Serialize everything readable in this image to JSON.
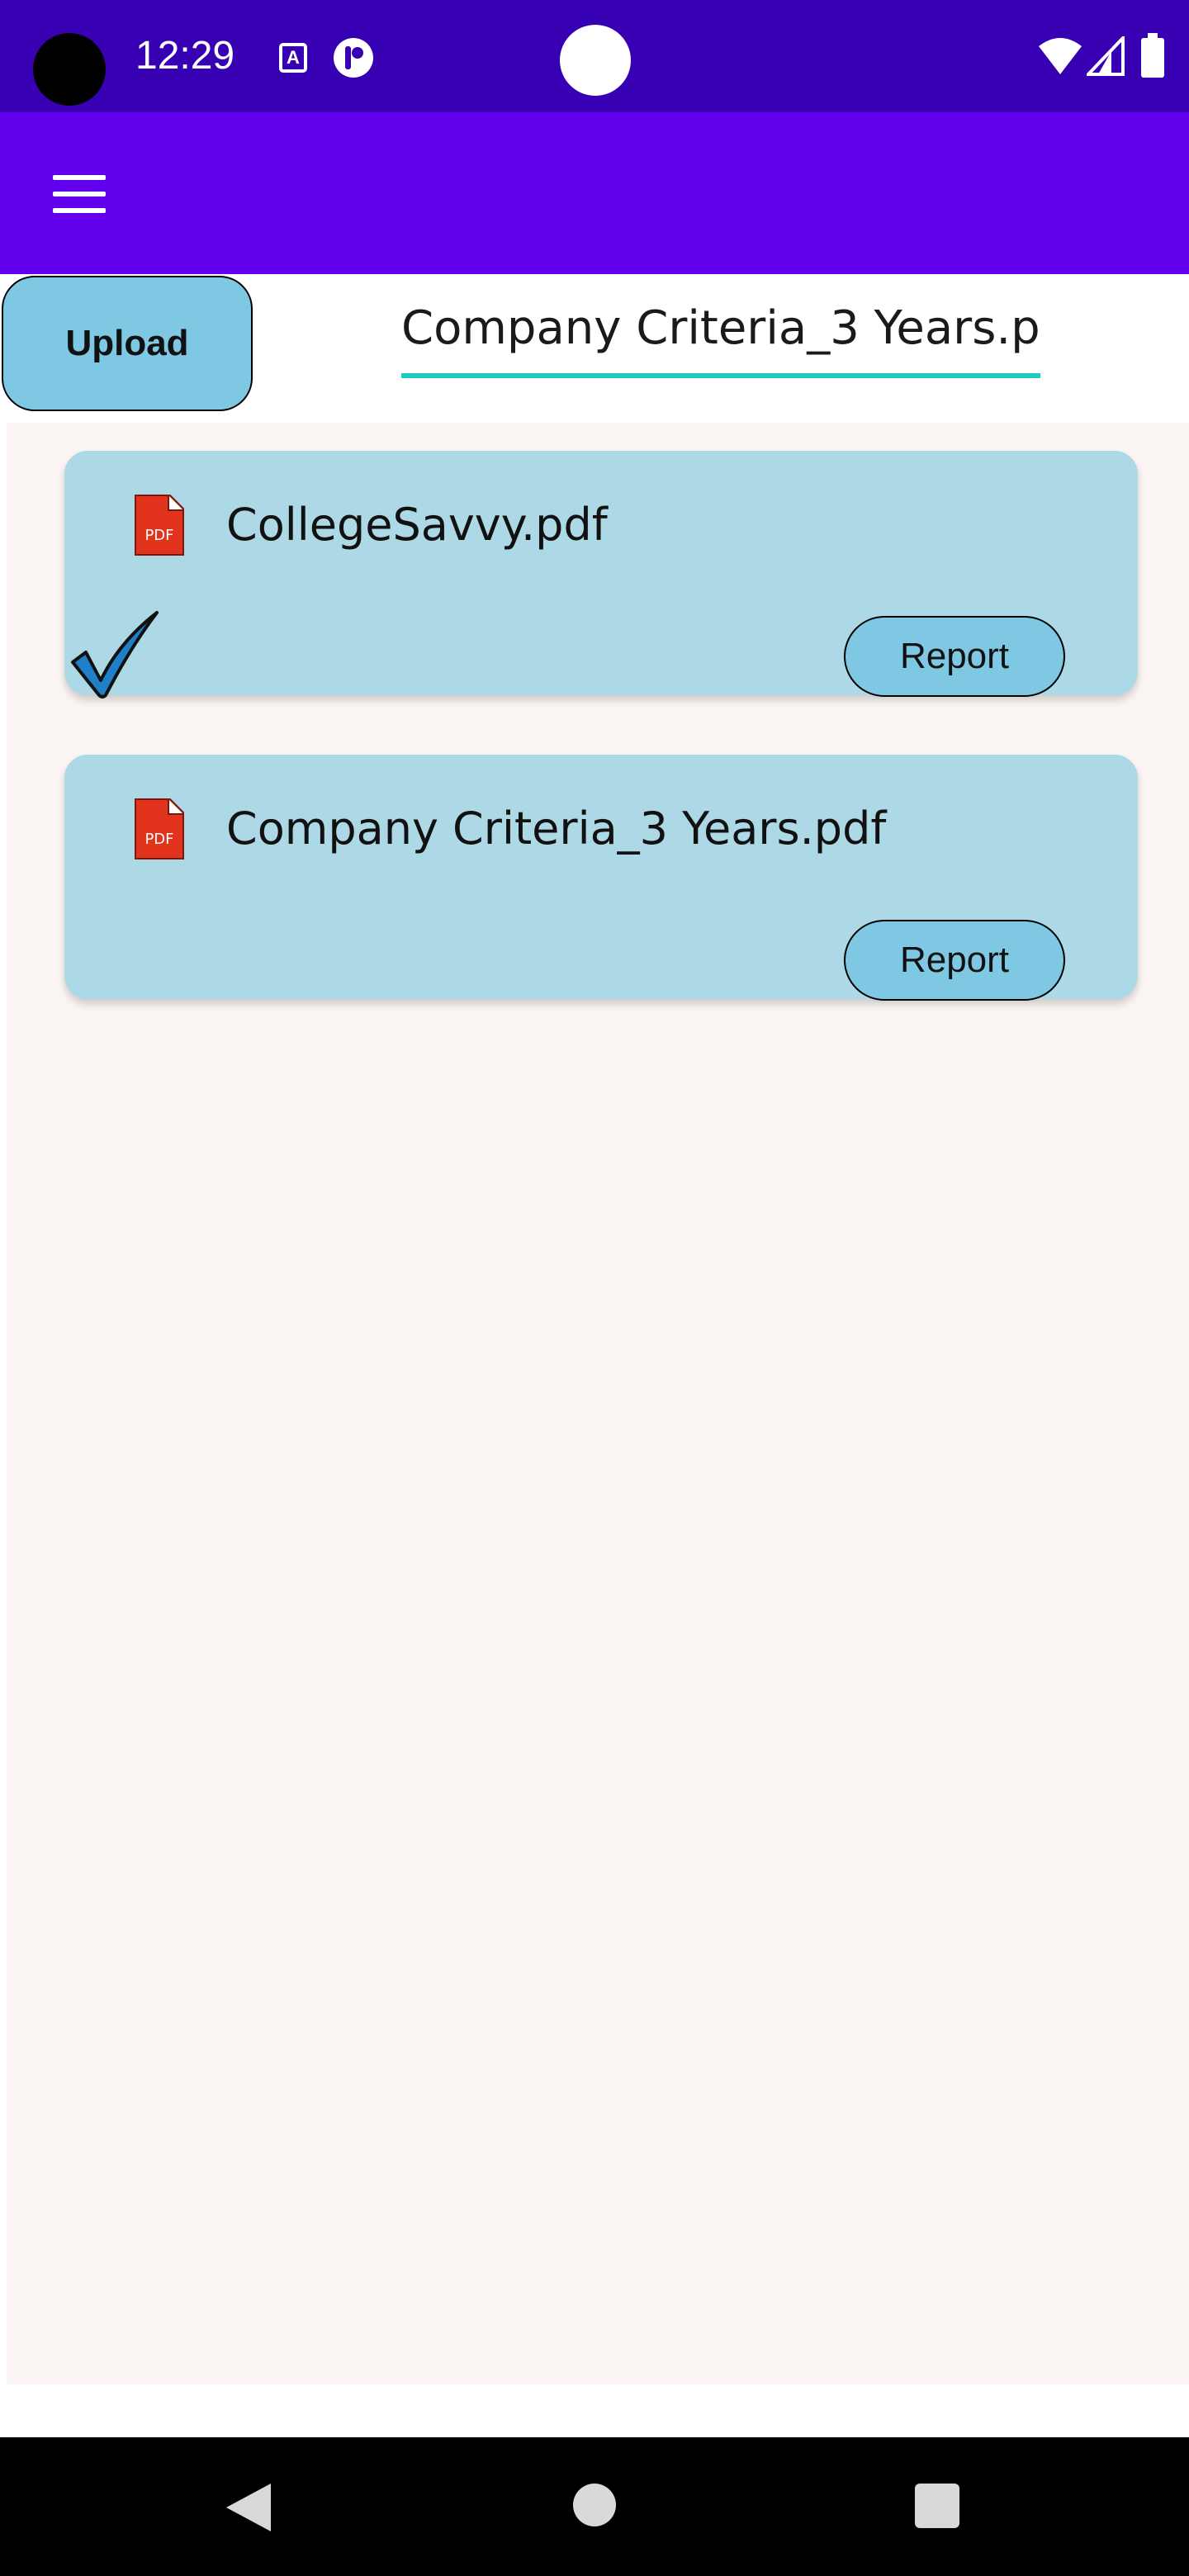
{
  "status_bar": {
    "time": "12:29",
    "notification_icons": [
      "text-a-icon",
      "p-app-icon"
    ],
    "system_icons": [
      "wifi-icon",
      "cell-signal-icon",
      "battery-icon"
    ]
  },
  "app_bar": {
    "menu_icon": "hamburger-menu-icon",
    "color": "#6200ee"
  },
  "upload": {
    "button_label": "Upload",
    "selected_file_value": "Company Criteria_3 Years.p",
    "underline_color": "#1ecbc1"
  },
  "files": [
    {
      "name": "CollegeSavvy.pdf",
      "icon": "pdf-icon",
      "report_label": "Report",
      "checked": true
    },
    {
      "name": "Company Criteria_3 Years.pdf",
      "icon": "pdf-icon",
      "report_label": "Report",
      "checked": false
    }
  ],
  "nav_bar": {
    "buttons": [
      "back-icon",
      "home-icon",
      "recents-icon"
    ]
  },
  "colors": {
    "status_bar": "#3700b3",
    "card_background": "#add8e6",
    "button_background": "#7ec8e3",
    "list_background": "#fbf5f4"
  }
}
